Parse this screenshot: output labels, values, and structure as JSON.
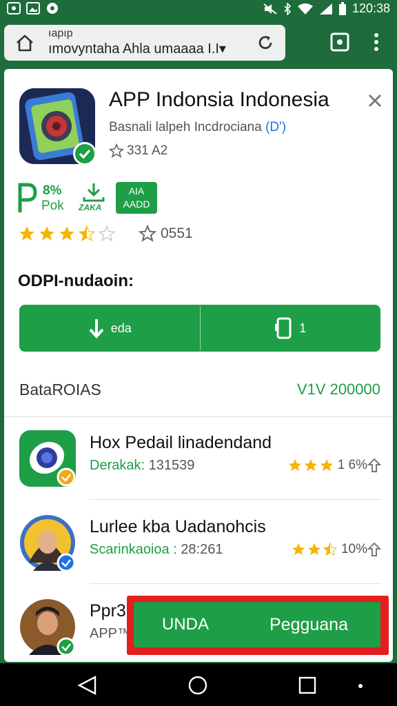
{
  "status_bar": {
    "time": "120:38"
  },
  "browser": {
    "url_line1": "ıapıp",
    "url_line2": "ımovyntaha Ahla umaaaa",
    "url_suffix": "I.I▾"
  },
  "app": {
    "title": "APP Indonsia Indonesia",
    "subtitle": "Basnali lalpeh Incdrociana",
    "subtitle_tag": "(D')",
    "rating_text": "331 A2"
  },
  "badges": {
    "pct": "8%",
    "pok": "Pok",
    "zaka": "ZAKA",
    "box_line1": "AIA",
    "box_line2": "AADD"
  },
  "rating": {
    "stars": 3.5,
    "count": "0551"
  },
  "section_title": "ODPI-nudaoin:",
  "actions": {
    "download_label": "eda",
    "second_label": "1"
  },
  "list_header": {
    "left": "BataROIAS",
    "right": "V1V 200000"
  },
  "list_items": [
    {
      "title": "Hox Pedail linadendand",
      "meta_label": "Derakak:",
      "meta_value": "131539",
      "stars": 3,
      "percent": "1 6%"
    },
    {
      "title": "Lurlee kba Uadanohcis",
      "meta_label": "Scarinkaoioa :",
      "meta_value": "28:261",
      "stars": 2.5,
      "percent": "10%"
    },
    {
      "title": "Ppr3",
      "meta_label": "APP™",
      "meta_value": "",
      "stars": 0,
      "percent": ""
    }
  ],
  "cta": {
    "left_label": "UNDA",
    "right_label": "Pegguana"
  },
  "colors": {
    "green": "#1e9e47",
    "dark_green": "#1e6b3c",
    "red": "#e31e1e",
    "star": "#f4b400"
  }
}
